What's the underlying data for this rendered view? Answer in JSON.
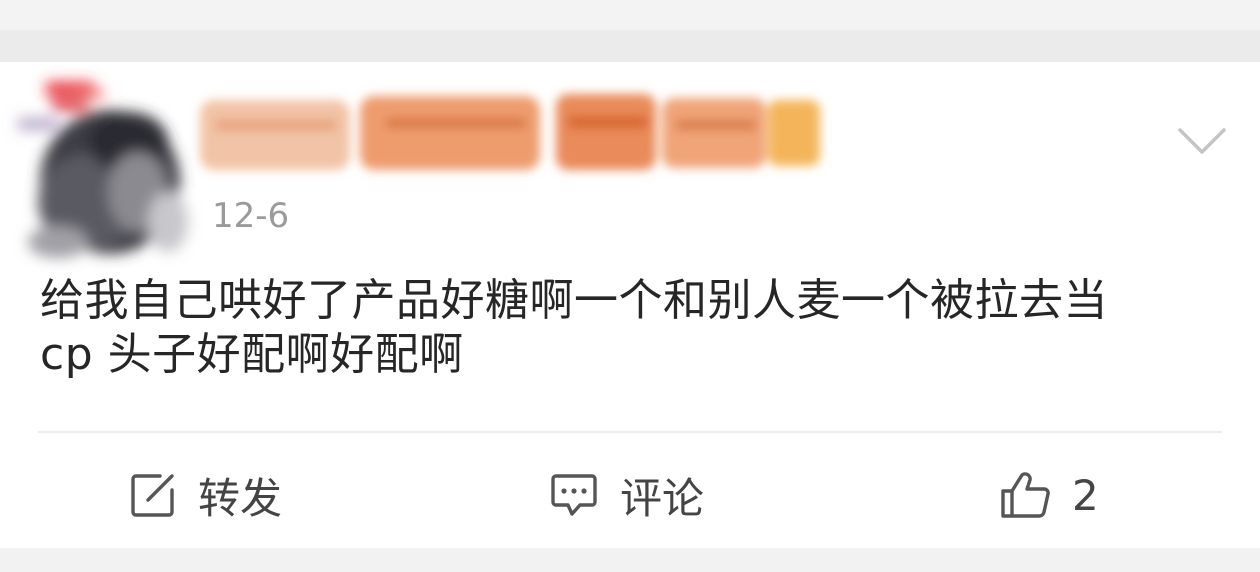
{
  "post": {
    "timestamp": "12-6",
    "text_line1": "给我自己哄好了产品好糖啊一个和别人麦一个被拉去当",
    "text_line2": "cp 头子好配啊好配啊"
  },
  "actions": {
    "repost_label": "转发",
    "comment_label": "评论",
    "like_count": "2"
  },
  "icons": {
    "repost": "edit-square-icon",
    "comment": "comment-bubble-icon",
    "like": "thumbs-up-icon",
    "more": "chevron-down-icon"
  },
  "colors": {
    "text": "#262626",
    "muted": "#9a9a9a",
    "action": "#444444",
    "background": "#f1f1f1",
    "card": "#ffffff"
  }
}
